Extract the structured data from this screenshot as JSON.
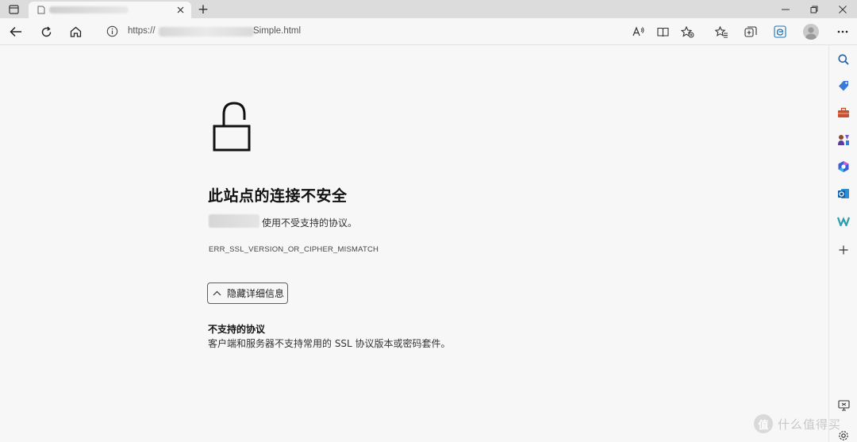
{
  "tabs": [
    {
      "title": "",
      "favicon": "page-icon",
      "active": true
    }
  ],
  "tabstrip": {
    "new_tab_label": "+"
  },
  "toolbar": {
    "url_prefix": "https://",
    "url_suffix": "Simple.html"
  },
  "error": {
    "title": "此站点的连接不安全",
    "description": "使用不受支持的协议。",
    "code": "ERR_SSL_VERSION_OR_CIPHER_MISMATCH",
    "details_button": "隐藏详细信息",
    "detail_heading": "不支持的协议",
    "detail_text": "客户端和服务器不支持常用的 SSL 协议版本或密码套件。"
  },
  "sidebar": {
    "items": [
      "search-icon",
      "shopping-tag-icon",
      "toolbox-icon",
      "games-icon",
      "office-icon",
      "outlook-icon",
      "designer-icon",
      "add-icon"
    ],
    "bottom_items": [
      "screenshot-icon",
      "settings-icon"
    ]
  },
  "watermark": {
    "logo": "值",
    "text": "什么值得买"
  },
  "colors": {
    "tabstrip": "#dcdcdc",
    "page_bg": "#f7f7f7",
    "text": "#1a1a1a",
    "accent": "#0b6bcb"
  }
}
